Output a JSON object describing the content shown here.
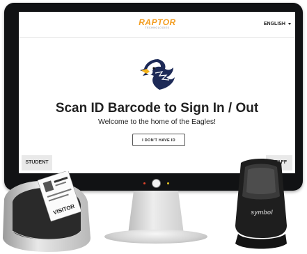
{
  "header": {
    "logo_main": "RAPTOR",
    "logo_sub": "TECHNOLOGIES",
    "language": "ENGLISH"
  },
  "main": {
    "heading": "Scan ID Barcode to Sign In / Out",
    "subheading": "Welcome to the home of the Eagles!",
    "no_id_button": "I DON'T HAVE ID"
  },
  "footer": {
    "student_button": "STUDENT",
    "staff_button": "STAFF"
  },
  "hardware": {
    "scanner_brand": "symbol",
    "badge_text": "VISITOR"
  },
  "colors": {
    "brand": "#f39c1e",
    "bezel": "#111214",
    "light_red": "#e0452b",
    "light_yellow": "#e6c521"
  },
  "icons": [
    "eagle-mascot-icon",
    "caret-down-icon",
    "power-button-icon"
  ]
}
